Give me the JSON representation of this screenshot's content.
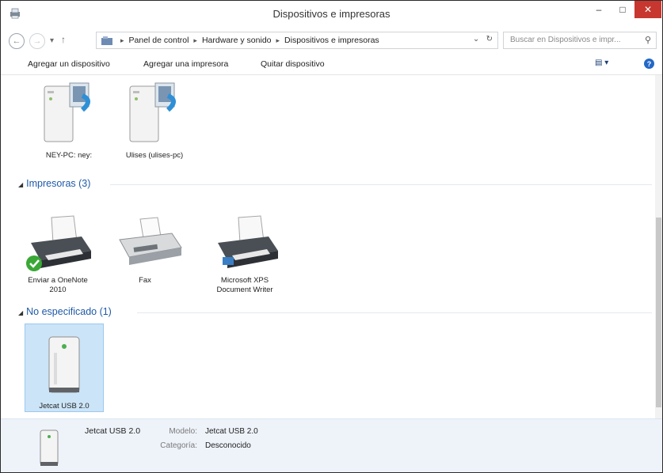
{
  "window": {
    "title": "Dispositivos e impresoras",
    "minimize": "–",
    "maximize": "□",
    "close": "✕"
  },
  "address": {
    "crumbs": [
      "Panel de control",
      "Hardware y sonido",
      "Dispositivos e impresoras"
    ],
    "separator": "▸",
    "search_placeholder": "Buscar en Dispositivos e impr..."
  },
  "commands": [
    "Agregar un dispositivo",
    "Agregar una impresora",
    "Quitar dispositivo"
  ],
  "help_label": "?",
  "top_devices": [
    {
      "label": "NEY-PC: ney:"
    },
    {
      "label": "Ulises (ulises-pc)"
    }
  ],
  "groups": {
    "printers": {
      "title": "Impresoras (3)"
    },
    "unspecified": {
      "title": "No especificado (1)"
    }
  },
  "printers": [
    {
      "label1": "Enviar a OneNote",
      "label2": "2010",
      "default": true
    },
    {
      "label1": "Fax",
      "label2": ""
    },
    {
      "label1": "Microsoft XPS",
      "label2": "Document Writer"
    }
  ],
  "unspecified_devices": [
    {
      "label": "Jetcat USB 2.0",
      "selected": true
    }
  ],
  "details": {
    "name": "Jetcat USB 2.0",
    "model_key": "Modelo:",
    "model_value": "Jetcat USB 2.0",
    "category_key": "Categoría:",
    "category_value": "Desconocido"
  },
  "colors": {
    "group_header": "#1e5aa8",
    "selection": "#cce4f7",
    "close": "#c7372f"
  }
}
